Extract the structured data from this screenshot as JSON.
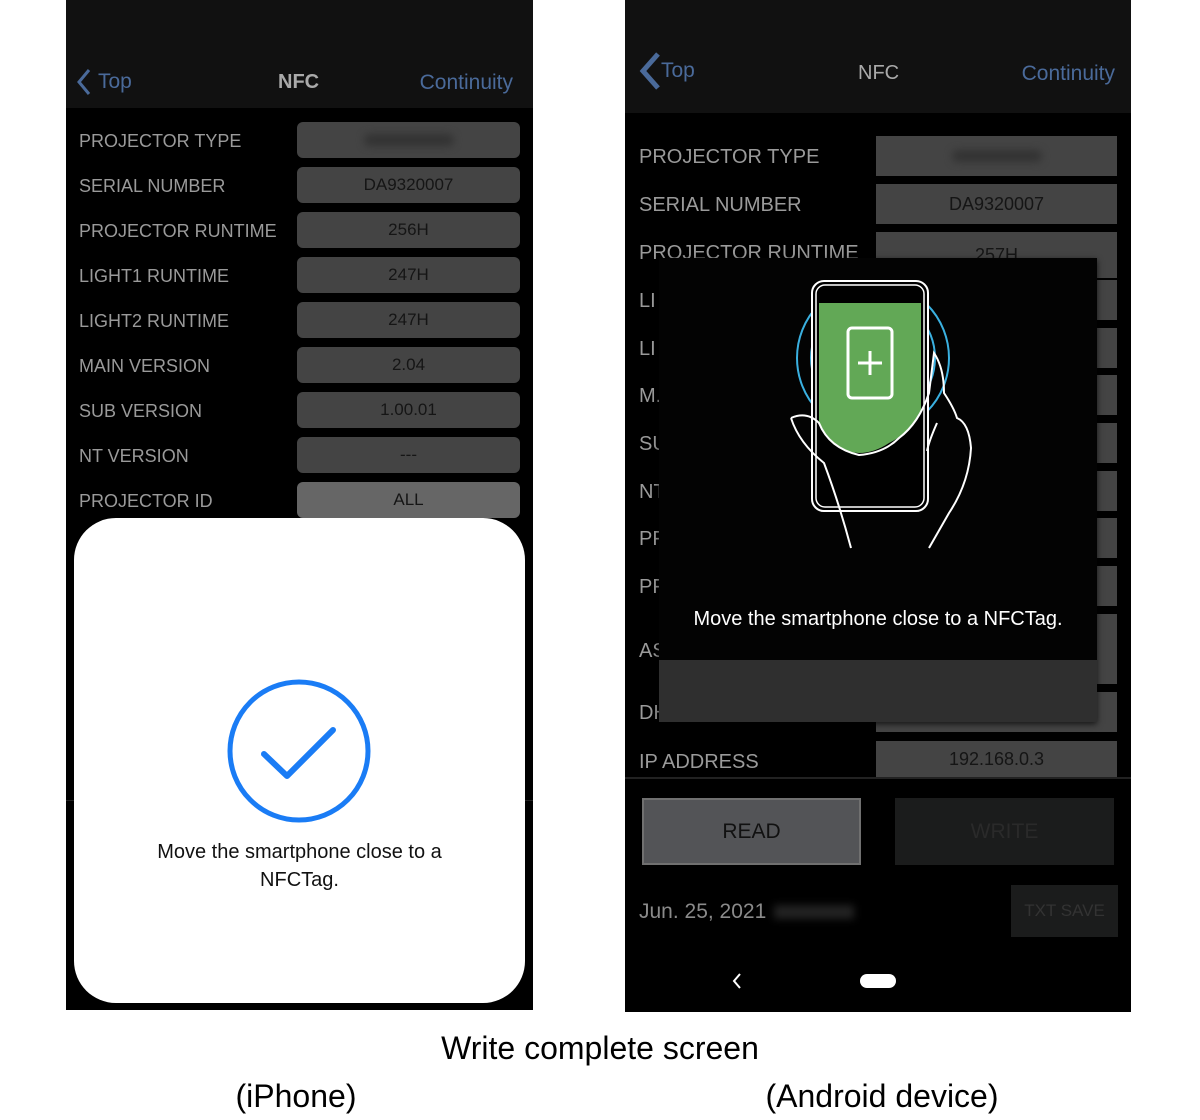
{
  "iphone": {
    "nav": {
      "back": "Top",
      "title": "NFC",
      "right": "Continuity"
    },
    "rows": [
      {
        "label": "PROJECTOR TYPE",
        "value": ""
      },
      {
        "label": "SERIAL NUMBER",
        "value": "DA9320007"
      },
      {
        "label": "PROJECTOR RUNTIME",
        "value": "256H"
      },
      {
        "label": "LIGHT1 RUNTIME",
        "value": "247H"
      },
      {
        "label": "LIGHT2 RUNTIME",
        "value": "247H"
      },
      {
        "label": "MAIN VERSION",
        "value": "2.04"
      },
      {
        "label": "SUB VERSION",
        "value": "1.00.01"
      },
      {
        "label": "NT VERSION",
        "value": "---"
      },
      {
        "label": "PROJECTOR ID",
        "value": "ALL"
      }
    ],
    "sheet": {
      "icon": "checkmark-circle-icon",
      "message": "Move the smartphone close to a NFCTag."
    }
  },
  "android": {
    "nav": {
      "back": "Top",
      "title": "NFC",
      "right": "Continuity"
    },
    "rows": [
      {
        "label": "PROJECTOR TYPE",
        "value": ""
      },
      {
        "label": "SERIAL NUMBER",
        "value": "DA9320007"
      },
      {
        "label": "PROJECTOR RUNTIME",
        "value": "257H"
      },
      {
        "label": "LI",
        "value": ""
      },
      {
        "label": "LI",
        "value": ""
      },
      {
        "label": "M.",
        "value": ""
      },
      {
        "label": "SU",
        "value": ""
      },
      {
        "label": "NT",
        "value": ""
      },
      {
        "label": "PF",
        "value": ""
      },
      {
        "label": "PF",
        "value": ""
      },
      {
        "label": "AS",
        "value": ""
      },
      {
        "label": "DH",
        "value": ""
      },
      {
        "label": "IP ADDRESS",
        "value": "192.168.0.3"
      }
    ],
    "dialog": {
      "message": "Move the smartphone close to a NFCTag.",
      "illustration": "hand-holding-phone-nfc-icon"
    },
    "buttons": {
      "read": "READ",
      "write": "WRITE",
      "txt_save": "TXT SAVE"
    },
    "date": "Jun. 25, 2021"
  },
  "captions": {
    "title": "Write complete screen",
    "left": "(iPhone)",
    "right": "(Android device)"
  },
  "colors": {
    "accent": "#1a7cf5",
    "link": "#4a6a9a",
    "green": "#62a856",
    "nfc_ring": "#3ab0e0"
  }
}
